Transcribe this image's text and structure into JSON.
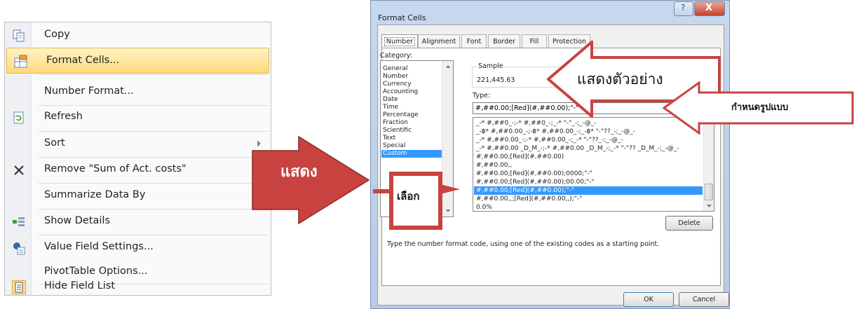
{
  "context_menu": {
    "items": [
      {
        "label": "Copy",
        "icon": "copy-icon"
      },
      {
        "label": "Format Cells...",
        "icon": "format-cells-icon"
      },
      {
        "label": "Number Format...",
        "icon": ""
      },
      {
        "label": "Refresh",
        "icon": "refresh-icon"
      },
      {
        "label": "Sort",
        "icon": ""
      },
      {
        "label": "Remove \"Sum of Act. costs\"",
        "icon": "remove-icon"
      },
      {
        "label": "Summarize Data By",
        "icon": ""
      },
      {
        "label": "Show Details",
        "icon": "show-details-icon"
      },
      {
        "label": "Value Field Settings...",
        "icon": "value-field-settings-icon"
      },
      {
        "label": "PivotTable Options...",
        "icon": ""
      },
      {
        "label": "Hide Field List",
        "icon": "hide-field-list-icon"
      }
    ]
  },
  "dialog": {
    "title": "Format Cells",
    "tabs": [
      "Number",
      "Alignment",
      "Font",
      "Border",
      "Fill",
      "Protection"
    ],
    "category_label": "Category:",
    "categories": [
      "General",
      "Number",
      "Currency",
      "Accounting",
      "Date",
      "Time",
      "Percentage",
      "Fraction",
      "Scientific",
      "Text",
      "Special",
      "Custom"
    ],
    "selected_category": "Custom",
    "sample_label": "Sample",
    "sample_value": "221,445.63",
    "type_label": "Type:",
    "type_value": "#,##0.00;[Red](#,##0.00);\"-\"",
    "formats": [
      "_-* #,##0_-;-* #,##0_-;_-* \"-\"_-;_-@_-",
      "_-฿* #,##0.00_-;-฿* #,##0.00_-;_-฿* \"-\"??_-;_-@_-",
      "_-* #,##0.00_-;-* #,##0.00_-;_-* \"-\"??_-;_-@_-",
      "_-* #,##0.00 _D_M_-;-* #,##0.00 _D_M_-;_-* \"-\"?? _D_M_-;_-@_-",
      "#,##0.00;[Red](#,##0.00)",
      "#,##0.00,,",
      "#,##0.00;[Red](#,##0.00);0000;\"-\"",
      "#,##0.00;[Red](#,##0.00);00.00;\"-\"",
      "#,##0.00;[Red](#,##0.00);\"-\"",
      "#,##0.00,,;[Red](#,##0.00,,);\"-\"",
      "0.0%"
    ],
    "selected_format_index": 8,
    "delete_label": "Delete",
    "hint": "Type the number format code, using one of the existing codes as a starting point.",
    "ok_label": "OK",
    "cancel_label": "Cancel",
    "help_label": "?",
    "close_label": "X"
  },
  "annotations": {
    "show_label": "แสดง",
    "choose_label": "เลือก",
    "sample_arrow_label": "แสดงตัวอย่าง",
    "type_arrow_label": "กำหนดรูปแบบ",
    "arrow_color": "#c8433f"
  }
}
